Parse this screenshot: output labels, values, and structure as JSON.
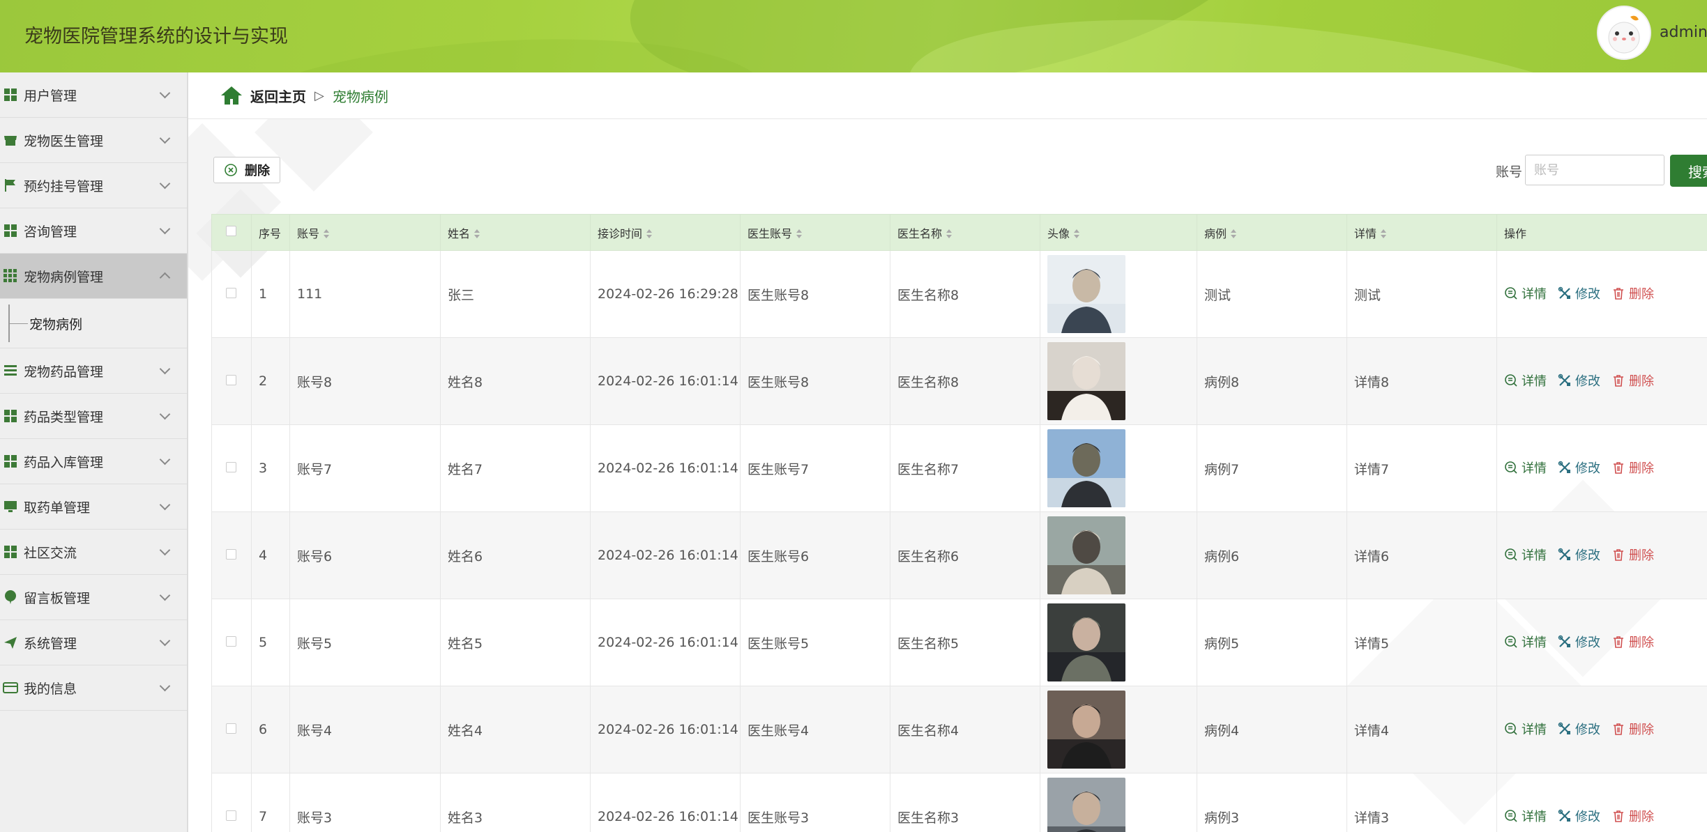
{
  "app": {
    "title": "宠物医院管理系统的设计与实现",
    "user": "admin"
  },
  "sidebar": {
    "items": [
      {
        "label": "用户管理",
        "icon": "grid-icon"
      },
      {
        "label": "宠物医生管理",
        "icon": "store-icon"
      },
      {
        "label": "预约挂号管理",
        "icon": "flag-icon"
      },
      {
        "label": "咨询管理",
        "icon": "grid-icon"
      },
      {
        "label": "宠物病例管理",
        "icon": "apps-icon",
        "active": true
      },
      {
        "label": "宠物药品管理",
        "icon": "list-icon"
      },
      {
        "label": "药品类型管理",
        "icon": "grid-icon"
      },
      {
        "label": "药品入库管理",
        "icon": "grid-icon"
      },
      {
        "label": "取药单管理",
        "icon": "monitor-icon"
      },
      {
        "label": "社区交流",
        "icon": "grid-icon"
      },
      {
        "label": "留言板管理",
        "icon": "balloon-icon"
      },
      {
        "label": "系统管理",
        "icon": "send-icon"
      },
      {
        "label": "我的信息",
        "icon": "card-icon"
      }
    ],
    "sub_item": "宠物病例"
  },
  "breadcrumb": {
    "home": "返回主页",
    "separator": "▷",
    "current": "宠物病例"
  },
  "toolbar": {
    "delete_label": "删除",
    "search_label": "账号",
    "search_placeholder": "账号",
    "search_button": "搜索"
  },
  "table": {
    "columns": [
      "序号",
      "账号",
      "姓名",
      "接诊时间",
      "医生账号",
      "医生名称",
      "头像",
      "病例",
      "详情",
      "操作"
    ],
    "actions": {
      "detail": "详情",
      "edit": "修改",
      "delete": "删除"
    },
    "rows": [
      {
        "no": "1",
        "account": "111",
        "name": "张三",
        "time": "2024-02-26 16:29:28",
        "doctor_account": "医生账号8",
        "doctor_name": "医生名称8",
        "case": "测试",
        "detail": "测试"
      },
      {
        "no": "2",
        "account": "账号8",
        "name": "姓名8",
        "time": "2024-02-26 16:01:14",
        "doctor_account": "医生账号8",
        "doctor_name": "医生名称8",
        "case": "病例8",
        "detail": "详情8"
      },
      {
        "no": "3",
        "account": "账号7",
        "name": "姓名7",
        "time": "2024-02-26 16:01:14",
        "doctor_account": "医生账号7",
        "doctor_name": "医生名称7",
        "case": "病例7",
        "detail": "详情7"
      },
      {
        "no": "4",
        "account": "账号6",
        "name": "姓名6",
        "time": "2024-02-26 16:01:14",
        "doctor_account": "医生账号6",
        "doctor_name": "医生名称6",
        "case": "病例6",
        "detail": "详情6"
      },
      {
        "no": "5",
        "account": "账号5",
        "name": "姓名5",
        "time": "2024-02-26 16:01:14",
        "doctor_account": "医生账号5",
        "doctor_name": "医生名称5",
        "case": "病例5",
        "detail": "详情5"
      },
      {
        "no": "6",
        "account": "账号4",
        "name": "姓名4",
        "time": "2024-02-26 16:01:14",
        "doctor_account": "医生账号4",
        "doctor_name": "医生名称4",
        "case": "病例4",
        "detail": "详情4"
      },
      {
        "no": "7",
        "account": "账号3",
        "name": "姓名3",
        "time": "2024-02-26 16:01:14",
        "doctor_account": "医生账号3",
        "doctor_name": "医生名称3",
        "case": "病例3",
        "detail": "详情3"
      }
    ]
  },
  "colors": {
    "accent": "#2f7d32",
    "header": "#a6d13f",
    "table_header": "#dff0d8"
  }
}
